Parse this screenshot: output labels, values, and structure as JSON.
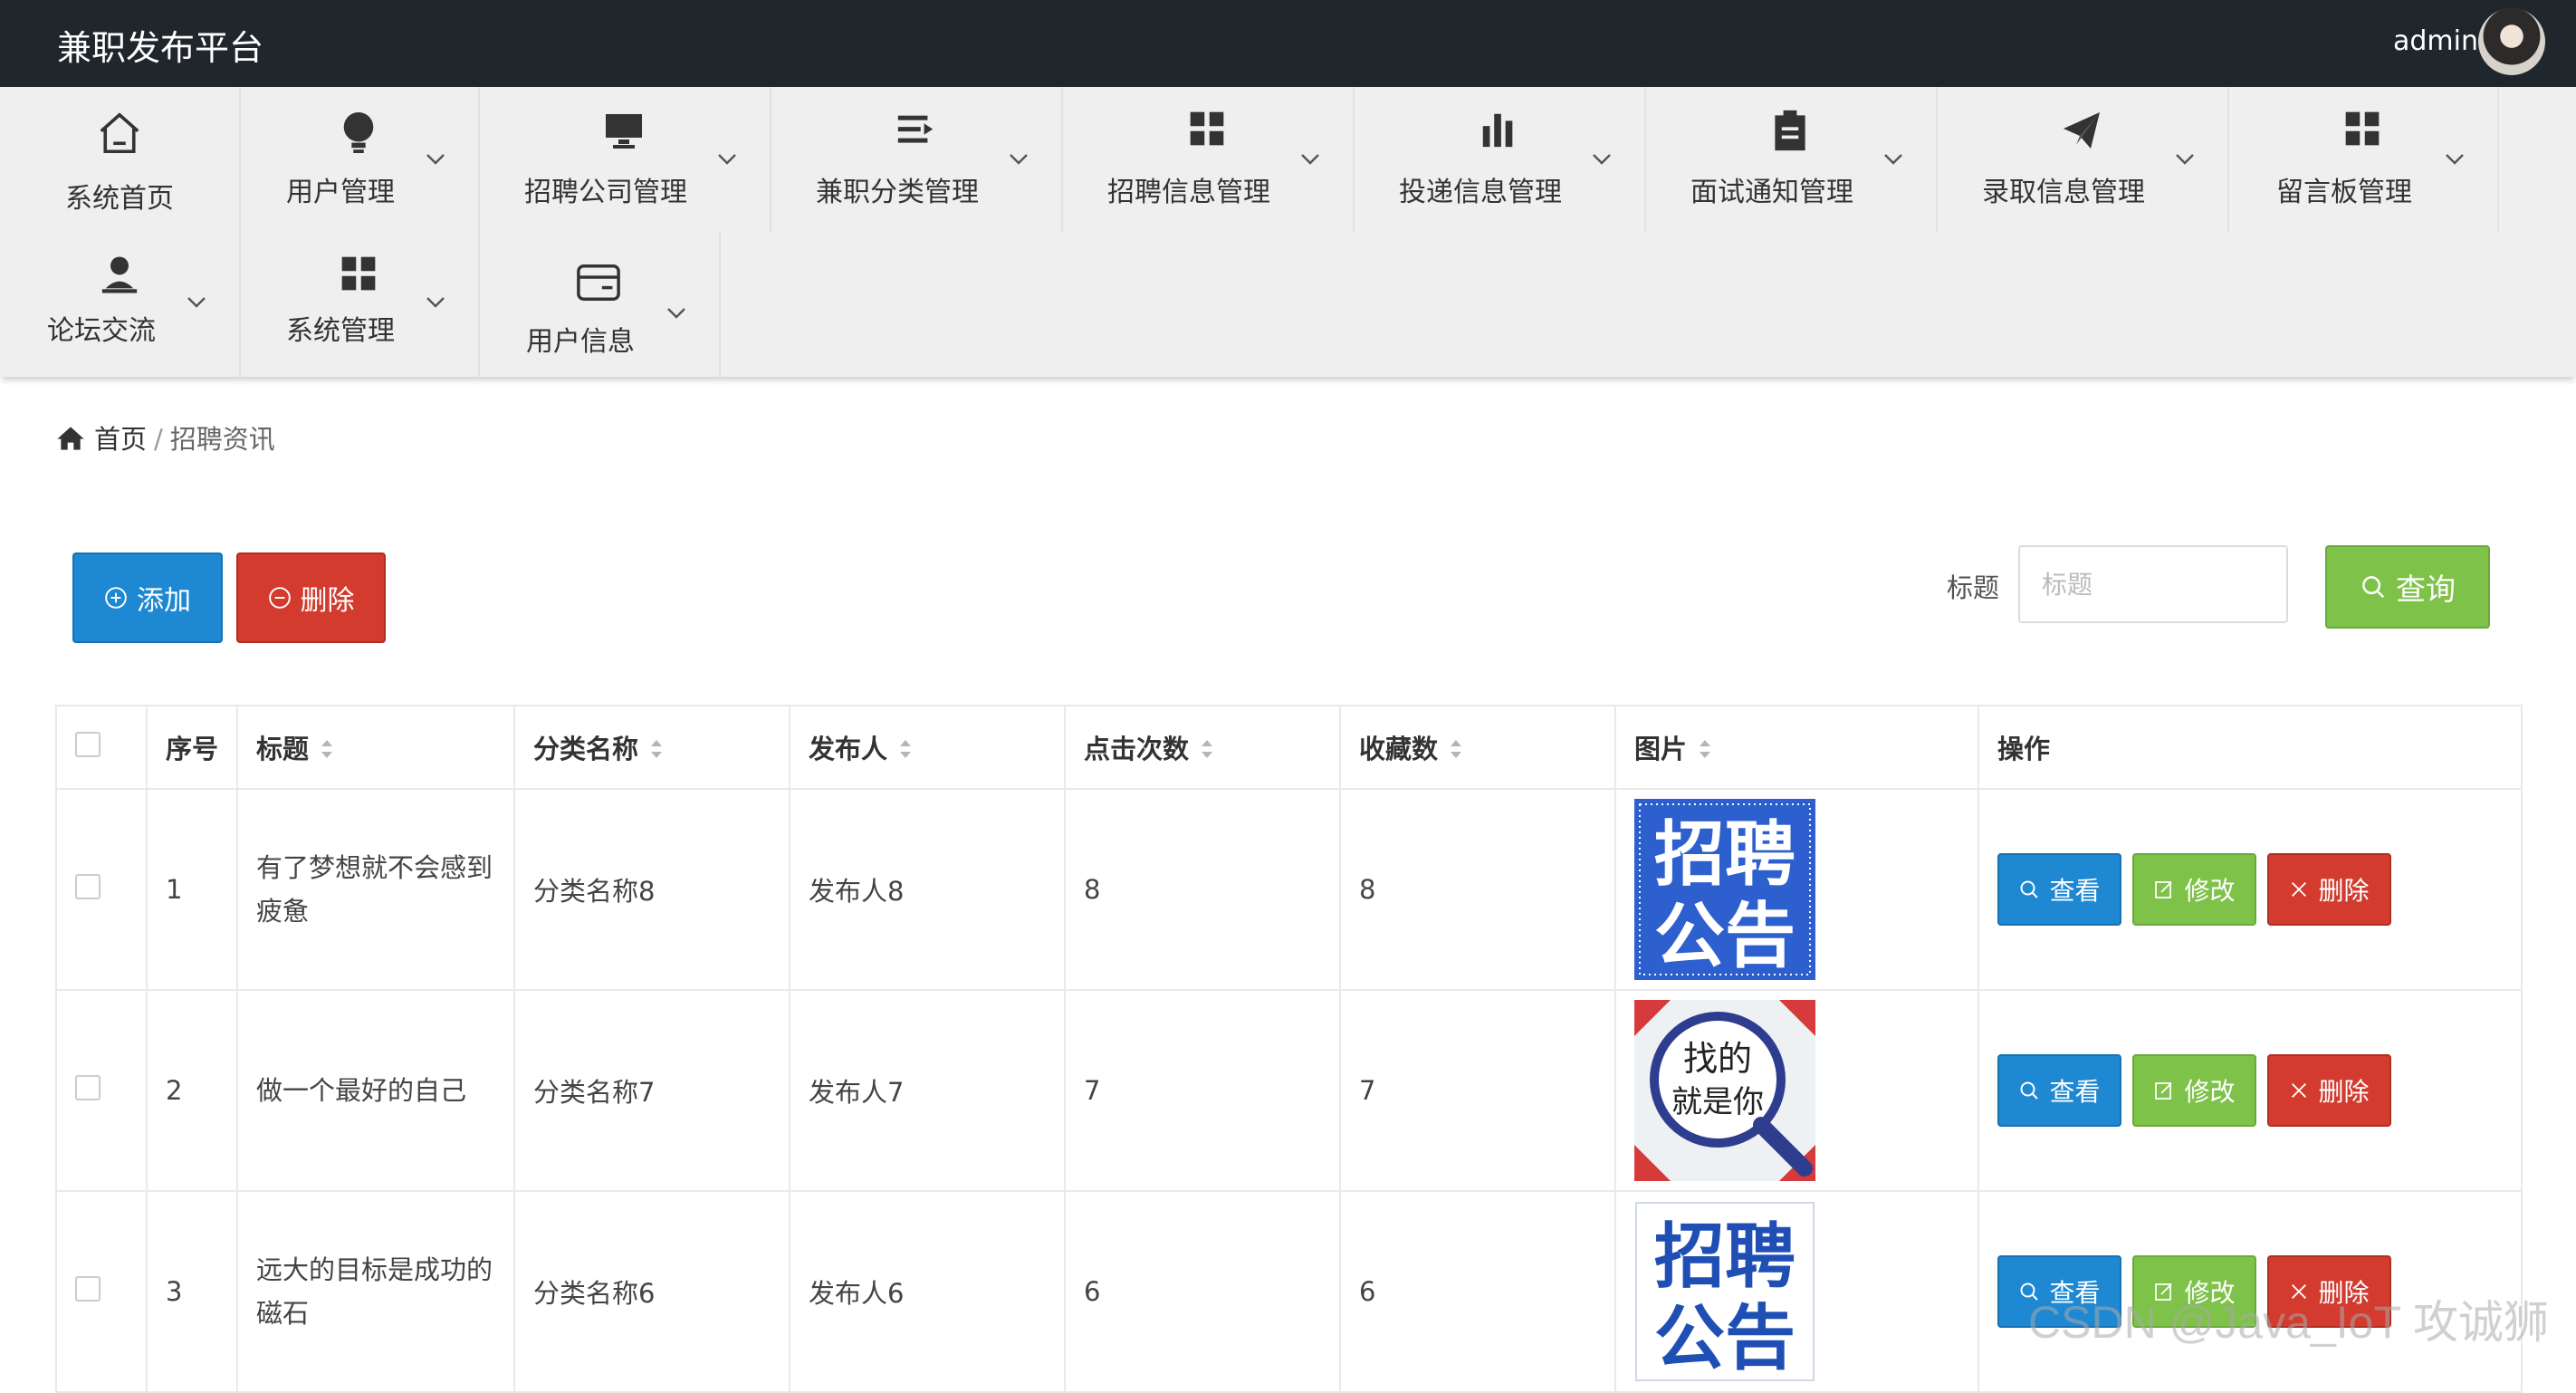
{
  "header": {
    "brand": "兼职发布平台",
    "username": "admin"
  },
  "nav": {
    "items": [
      {
        "label": "系统首页",
        "icon": "home-icon"
      },
      {
        "label": "用户管理",
        "icon": "bulb-icon"
      },
      {
        "label": "招聘公司管理",
        "icon": "monitor-icon"
      },
      {
        "label": "兼职分类管理",
        "icon": "list-icon"
      },
      {
        "label": "招聘信息管理",
        "icon": "grid-icon"
      },
      {
        "label": "投递信息管理",
        "icon": "bar-chart-icon"
      },
      {
        "label": "面试通知管理",
        "icon": "clipboard-icon"
      },
      {
        "label": "录取信息管理",
        "icon": "send-icon"
      },
      {
        "label": "留言板管理",
        "icon": "grid-icon"
      },
      {
        "label": "论坛交流",
        "icon": "user-icon"
      },
      {
        "label": "系统管理",
        "icon": "grid-icon"
      },
      {
        "label": "用户信息",
        "icon": "card-icon"
      }
    ]
  },
  "breadcrumb": {
    "home": "首页",
    "separator": "/",
    "current": "招聘资讯"
  },
  "toolbar": {
    "add_label": "添加",
    "delete_label": "删除",
    "search_label": "标题",
    "search_placeholder": "标题",
    "search_value": "",
    "query_label": "查询"
  },
  "table": {
    "columns": [
      "序号",
      "标题",
      "分类名称",
      "发布人",
      "点击次数",
      "收藏数",
      "图片",
      "操作"
    ],
    "rows": [
      {
        "index": "1",
        "title": "有了梦想就不会感到疲惫",
        "category": "分类名称8",
        "publisher": "发布人8",
        "clicks": "8",
        "favorites": "8",
        "image_text": [
          "招聘",
          "公告"
        ]
      },
      {
        "index": "2",
        "title": "做一个最好的自己",
        "category": "分类名称7",
        "publisher": "发布人7",
        "clicks": "7",
        "favorites": "7",
        "image_text": [
          "找的",
          "就是你"
        ]
      },
      {
        "index": "3",
        "title": "远大的目标是成功的磁石",
        "category": "分类名称6",
        "publisher": "发布人6",
        "clicks": "6",
        "favorites": "6",
        "image_text": [
          "招聘",
          "公告"
        ]
      }
    ],
    "actions": {
      "view": "查看",
      "edit": "修改",
      "delete": "删除"
    }
  },
  "watermark": "CSDN @Java_IoT 攻诚狮",
  "colors": {
    "topbar": "#20272c",
    "primary": "#1e88d2",
    "danger": "#d23b2e",
    "success": "#7fc24a",
    "nav_bg": "#efefef"
  }
}
